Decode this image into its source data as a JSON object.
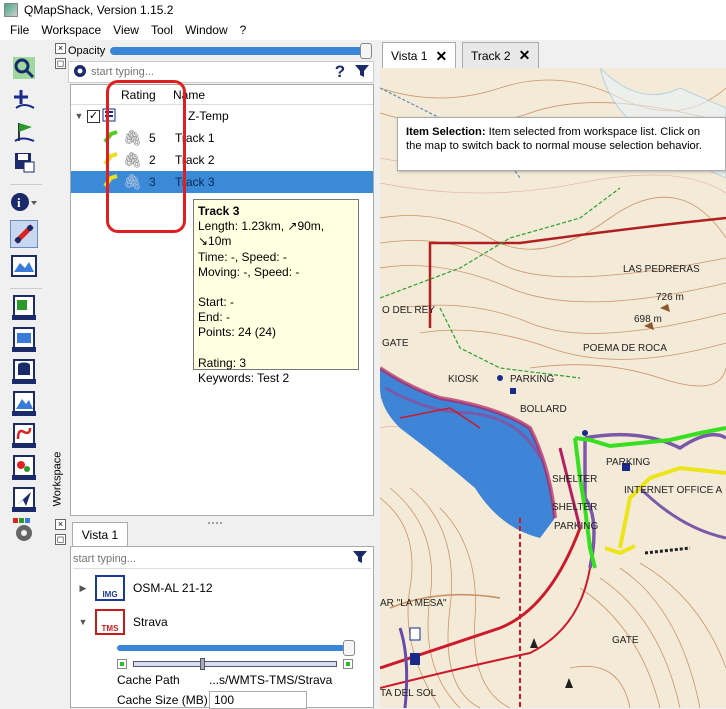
{
  "window": {
    "title": "QMapShack, Version 1.15.2"
  },
  "menu": [
    "File",
    "Workspace",
    "View",
    "Tool",
    "Window",
    "?"
  ],
  "workspace": {
    "dock_label": "Workspace",
    "opacity_label": "Opacity",
    "opacity": 1.0,
    "search_placeholder": "start typing...",
    "columns": {
      "rating": "Rating",
      "name": "Name"
    },
    "project": {
      "name": "Z-Temp",
      "checked": true
    },
    "tracks": [
      {
        "rating": "5",
        "name": "Track 1",
        "color": "#55cc22",
        "selected": false
      },
      {
        "rating": "2",
        "name": "Track 2",
        "color": "#e8e020",
        "selected": false
      },
      {
        "rating": "3",
        "name": "Track 3",
        "color": "#e8e020",
        "selected": true
      }
    ]
  },
  "tooltip": {
    "title": "Track 3",
    "lines": [
      "Length: 1.23km, ↗90m, ↘10m",
      "Time: -, Speed: -",
      "Moving: -, Speed: -",
      "",
      "Start: -",
      "End: -",
      "Points: 24 (24)",
      "",
      "Rating: 3",
      "Keywords: Test 2"
    ]
  },
  "map_panel": {
    "tab_label": "Vista 1",
    "search_placeholder": "start typing...",
    "maps": [
      {
        "badge": "IMG",
        "name": "OSM-AL 21-12",
        "expanded": false,
        "color": "#1a3a9a"
      },
      {
        "badge": "TMS",
        "name": "Strava",
        "expanded": true,
        "color": "#cc1a1a"
      }
    ],
    "strava_opacity": 0.97,
    "range_min": 0.2,
    "range_max": 0.98,
    "cache_path_label": "Cache Path",
    "cache_path_value": "...s/WMTS-TMS/Strava",
    "cache_size_label": "Cache Size (MB)",
    "cache_size_value": "100"
  },
  "map_tabs": [
    {
      "label": "Vista 1",
      "active": true
    },
    {
      "label": "Track 2",
      "active": false
    }
  ],
  "infobox": {
    "bold": "Item Selection:",
    "text": " Item selected from workspace list. Click on the map to switch back to normal mouse selection behavior."
  },
  "map_labels": [
    "LAS PEDRERAS",
    "726 m",
    "698 m",
    "O DEL REY",
    "POEMA DE ROCA",
    "KIOSK",
    "PARKING",
    "BOLLARD",
    "PARKING",
    "INTERNET OFFICE A",
    "SHELTER",
    "SHELTER",
    "PARKING",
    "GATE",
    "AR \"LA MESA\"",
    "TA DEL SOL",
    "GATE"
  ],
  "colors": {
    "selection": "#3a8ad8",
    "tooltip_bg": "#ffffe1",
    "annotation": "#e02020",
    "slider": "#3a86d6",
    "map_bg": "#f4ead8"
  }
}
